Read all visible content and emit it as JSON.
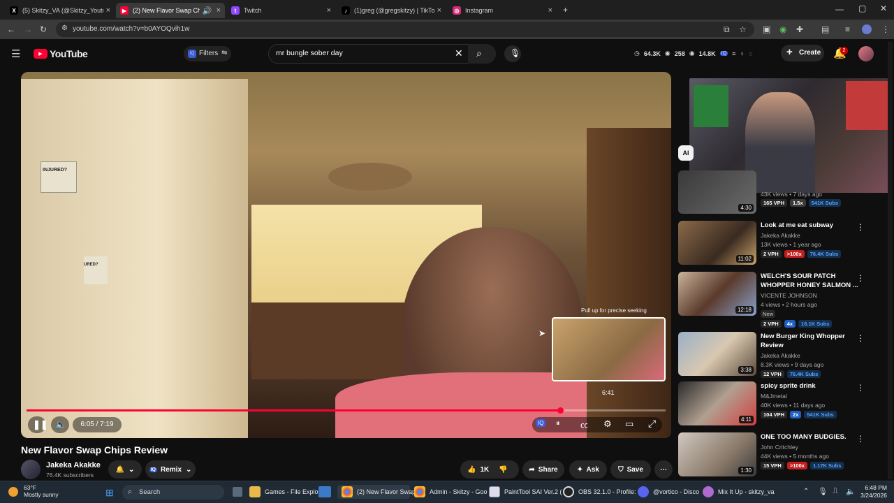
{
  "browser": {
    "tabs": [
      {
        "title": "(5) Skitzy_VA (@Skitzy_Youtube",
        "icon": "x-icon",
        "color": "#000000"
      },
      {
        "title": "(2) New Flavor Swap Chips",
        "icon": "youtube-icon",
        "color": "#ff0033",
        "active": true
      },
      {
        "title": "Twitch",
        "icon": "twitch-icon",
        "color": "#9146ff"
      },
      {
        "title": "(1)greg (@gregskitzy) | TikTok",
        "icon": "tiktok-icon",
        "color": "#000000"
      },
      {
        "title": "Instagram",
        "icon": "instagram-icon",
        "color": "#d62976"
      }
    ],
    "url": "youtube.com/watch?v=b0AYOQvih1w"
  },
  "header": {
    "logo": "YouTube",
    "filters_label": "Filters",
    "search_value": "mr bungle sober day",
    "stat_views": "64.3K",
    "stat_likes": "258",
    "stat_subs": "14.8K",
    "create_label": "Create",
    "notif_count": "2"
  },
  "player": {
    "current_time": "6:05 / 7:19",
    "progress_fraction": 0.835,
    "hover_time": "6:41",
    "seek_hint": "Pull up for precise seeking",
    "fridge_note_1": "INJURED?",
    "fridge_note_2": "URED?"
  },
  "video": {
    "title": "New Flavor Swap Chips Review",
    "channel": "Jakeka Akakke",
    "subscribers": "76.4K subscribers",
    "remix_label": "Remix",
    "likes": "1K",
    "share_label": "Share",
    "ask_label": "Ask",
    "save_label": "Save"
  },
  "sidebar": {
    "chip": "Al",
    "partial_card": {
      "meta": "43K views • 7 days ago",
      "duration": "4:30",
      "vph": "165 VPH",
      "mult": "1.5x",
      "subs": "541K Subs"
    },
    "items": [
      {
        "title": "Look at me eat subway",
        "channel": "Jakeka Akakke",
        "meta": "13K views • 1 year ago",
        "duration": "11:02",
        "vph": "2 VPH",
        "mult": ">100x",
        "subs": "76.4K Subs",
        "badge": ""
      },
      {
        "title": "WELCH'S SOUR PATCH WHOPPER HONEY SALMON ...",
        "channel": "VICENTE JOHNSON",
        "meta": "4 views • 2 hours ago",
        "duration": "12:18",
        "vph": "2 VPH",
        "mult": "4x",
        "subs": "16.1K Subs",
        "badge": "New"
      },
      {
        "title": "New Burger King Whopper Review",
        "channel": "Jakeka Akakke",
        "meta": "8.3K views • 9 days ago",
        "duration": "3:38",
        "vph": "12 VPH",
        "mult": "",
        "subs": "76.4K Subs",
        "badge": ""
      },
      {
        "title": "spicy sprite drink",
        "channel": "M&Jmetal",
        "meta": "40K views • 11 days ago",
        "duration": "4:11",
        "vph": "104 VPH",
        "mult": "2x",
        "subs": "541K Subs",
        "badge": ""
      },
      {
        "title": "ONE TOO MANY BUDGIES.",
        "channel": "John Critchley",
        "meta": "44K views • 5 months ago",
        "duration": "1:30",
        "vph": "15 VPH",
        "mult": ">100x",
        "subs": "1.17K Subs",
        "badge": ""
      }
    ]
  },
  "taskbar": {
    "weather_temp": "63°F",
    "weather_desc": "Mostly sunny",
    "search_label": "Search",
    "apps": [
      {
        "label": "Games - File Explo",
        "icon": "folder-icon"
      },
      {
        "label": "(2) New Flavor Swap",
        "icon": "chrome-icon",
        "active": true
      },
      {
        "label": "Admin - Skitzy - Goo",
        "icon": "chrome-icon"
      },
      {
        "label": "PaintTool SAI Ver.2 (",
        "icon": "painttool-icon"
      },
      {
        "label": "OBS 32.1.0 - Profile:",
        "icon": "obs-icon"
      },
      {
        "label": "@vortico - Disco",
        "icon": "discord-icon"
      },
      {
        "label": "Mix It Up - skitzy_va",
        "icon": "mixitup-icon"
      }
    ],
    "time": "6:48 PM",
    "date": "3/24/2026"
  }
}
